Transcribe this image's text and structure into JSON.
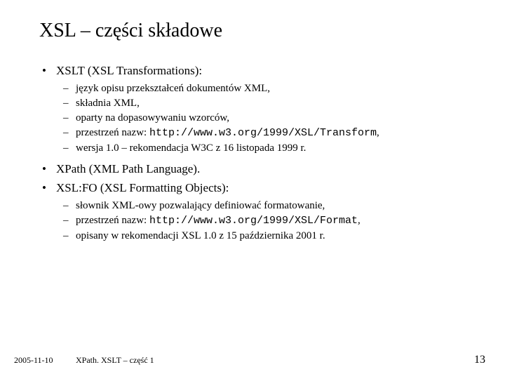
{
  "title": "XSL – części składowe",
  "items": [
    {
      "label": "XSLT (XSL Transformations):",
      "sub": [
        {
          "text": "język opisu przekształceń dokumentów XML,"
        },
        {
          "text": "składnia XML,"
        },
        {
          "text": "oparty na dopasowywaniu wzorców,"
        },
        {
          "prefix": "przestrzeń nazw: ",
          "code": "http://www.w3.org/1999/XSL/Transform",
          "suffix": ","
        },
        {
          "text": "wersja 1.0 – rekomendacja W3C z 16 listopada 1999 r."
        }
      ]
    },
    {
      "label": "XPath (XML Path Language).",
      "sub": []
    },
    {
      "label": "XSL:FO (XSL Formatting Objects):",
      "sub": [
        {
          "text": "słownik XML-owy pozwalający definiować formatowanie,"
        },
        {
          "prefix": "przestrzeń nazw: ",
          "code": "http://www.w3.org/1999/XSL/Format",
          "suffix": ","
        },
        {
          "text": "opisany w rekomendacji XSL 1.0 z 15 października 2001 r."
        }
      ]
    }
  ],
  "footer": {
    "date": "2005-11-10",
    "title": "XPath. XSLT – część 1",
    "page": "13"
  }
}
